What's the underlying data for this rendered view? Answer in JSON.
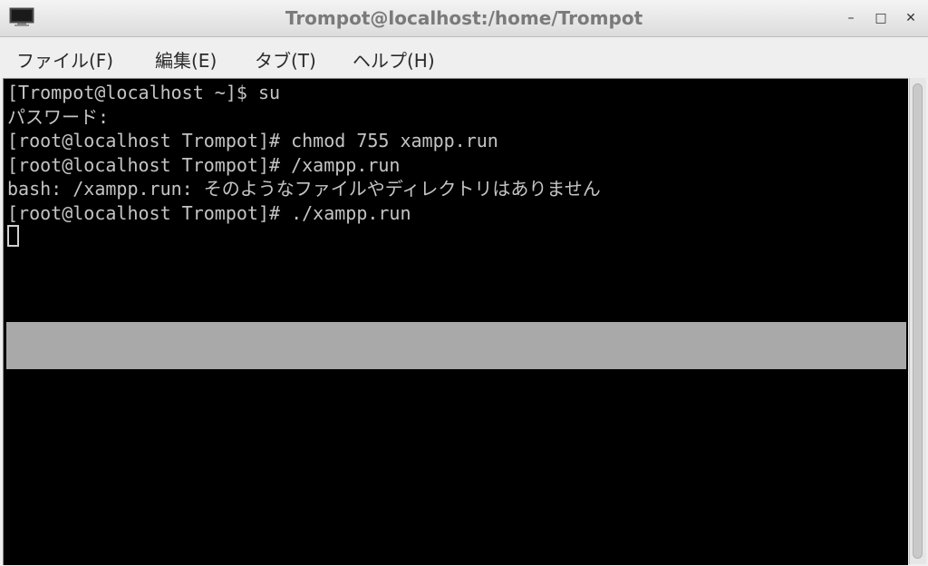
{
  "window": {
    "title": "Trompot@localhost:/home/Trompot",
    "icon": "terminal-icon",
    "controls": {
      "minimize": "–",
      "maximize": "□",
      "close": "✕"
    }
  },
  "menubar": {
    "items": [
      {
        "label": "ファイル(F)"
      },
      {
        "label": "編集(E)"
      },
      {
        "label": "タブ(T)"
      },
      {
        "label": "ヘルプ(H)"
      }
    ]
  },
  "terminal": {
    "lines": [
      "[Trompot@localhost ~]$ su",
      "パスワード:",
      "[root@localhost Trompot]# chmod 755 xampp.run",
      "[root@localhost Trompot]# /xampp.run",
      "bash: /xampp.run: そのようなファイルやディレクトリはありません",
      "[root@localhost Trompot]# ./xampp.run"
    ],
    "colors": {
      "background": "#000000",
      "text": "#c4c4c4",
      "selection": "#a9a9a9"
    }
  }
}
